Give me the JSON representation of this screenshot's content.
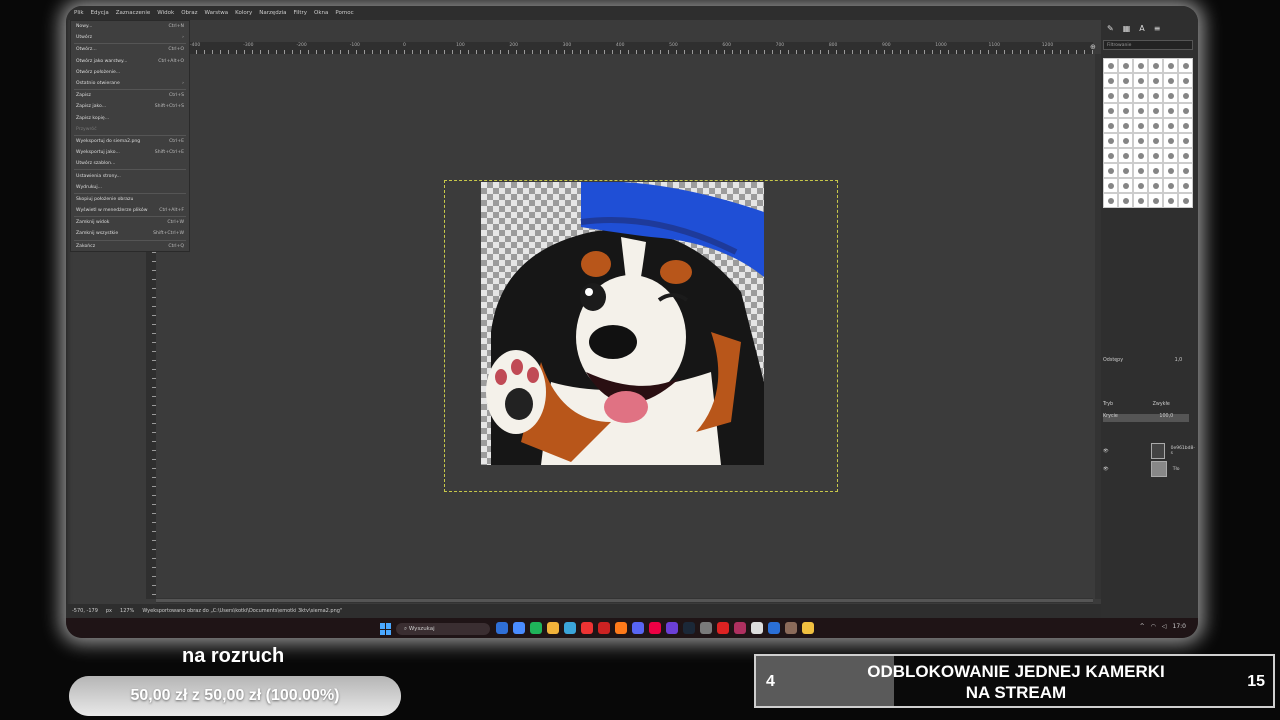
{
  "menubar": [
    "Plik",
    "Edycja",
    "Zaznaczenie",
    "Widok",
    "Obraz",
    "Warstwa",
    "Kolory",
    "Narzędzia",
    "Filtry",
    "Okna",
    "Pomoc"
  ],
  "file_menu": {
    "items": [
      {
        "label": "Nowy...",
        "shortcut": "Ctrl+N"
      },
      {
        "label": "Utwórz",
        "shortcut": "›"
      },
      {
        "label": "Otwórz...",
        "shortcut": "Ctrl+O"
      },
      {
        "label": "Otwórz jako warstwy...",
        "shortcut": "Ctrl+Alt+O"
      },
      {
        "label": "Otwórz położenie...",
        "shortcut": ""
      },
      {
        "label": "Ostatnio otwierane",
        "shortcut": "›"
      },
      {
        "label": "Zapisz",
        "shortcut": "Ctrl+S"
      },
      {
        "label": "Zapisz jako...",
        "shortcut": "Shift+Ctrl+S"
      },
      {
        "label": "Zapisz kopię...",
        "shortcut": ""
      },
      {
        "label": "Przywróć",
        "shortcut": "",
        "disabled": true
      },
      {
        "label": "Wyeksportuj do siema2.png",
        "shortcut": "Ctrl+E"
      },
      {
        "label": "Wyeksportuj jako...",
        "shortcut": "Shift+Ctrl+E"
      },
      {
        "label": "Utwórz szablon...",
        "shortcut": ""
      },
      {
        "label": "Ustawienia strony...",
        "shortcut": ""
      },
      {
        "label": "Wydrukuj...",
        "shortcut": ""
      },
      {
        "label": "Skopiuj położenie obrazu",
        "shortcut": ""
      },
      {
        "label": "Wyświetl w menedżerze plików",
        "shortcut": "Ctrl+Alt+F"
      },
      {
        "label": "Zamknij widok",
        "shortcut": "Ctrl+W"
      },
      {
        "label": "Zamknij wszystkie",
        "shortcut": "Shift+Ctrl+W"
      },
      {
        "label": "Zakończ",
        "shortcut": "Ctrl+Q"
      }
    ]
  },
  "ruler_top": {
    "labels": [
      "-400",
      "-300",
      "-200",
      "-100",
      "0",
      "100",
      "200",
      "300",
      "400",
      "500",
      "600",
      "700",
      "800",
      "900",
      "1000",
      "1100",
      "1200"
    ]
  },
  "statusbar": {
    "coords": "-570, -179",
    "unit": "px",
    "zoom": "127%",
    "message": "Wyeksportowano obraz do „C:\\Users\\kotki\\Documents\\emotki 3ktv\\siema2.png\""
  },
  "right_dock": {
    "filter_placeholder": "Filtrowanie",
    "spacing_label": "Odstępy",
    "spacing_value": "1,0",
    "mode_label": "Tryb",
    "mode_value": "Zwykłe",
    "opacity_label": "Krycie",
    "opacity_value": "100,0",
    "layers": [
      {
        "name": "0e961bd8-s"
      },
      {
        "name": "Tło"
      }
    ]
  },
  "taskbar": {
    "search_placeholder": "Wyszukaj",
    "time": "17:0"
  },
  "overlay": {
    "donation_title": "na rozruch",
    "donation_text": "50,00 zł z 50,00 zł (100.00%)",
    "donation_progress": 1.0,
    "unlock_current": "4",
    "unlock_text_line1": "ODBLOKOWANIE JEDNEJ KAMERKI",
    "unlock_text_line2": "NA STREAM",
    "unlock_goal": "15",
    "unlock_progress": 0.2667
  },
  "colors": {
    "gimp_bg": "#3b3b3b",
    "selection_outline": "#c8c84a",
    "cap_blue": "#1f4fd6",
    "taskbar_bg": "#1f1416"
  }
}
